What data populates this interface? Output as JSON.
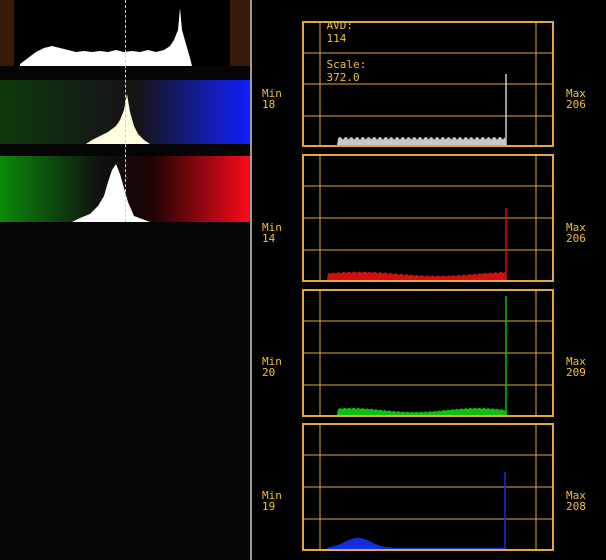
{
  "header": {
    "avd_label": "AVD:",
    "avd_value": "114",
    "scale_label": "Scale:",
    "scale_value": "372.0"
  },
  "colors": {
    "accent": "#e8a73a",
    "text": "#f2c230",
    "luma": "#c8c8c8",
    "red": "#d01010",
    "green": "#10c010",
    "blue": "#1030e0"
  },
  "left_bands": [
    {
      "name": "luma",
      "strip_colors": [
        "#3a1a08",
        "#000000",
        "#3a1a08"
      ]
    },
    {
      "name": "blue-yellow",
      "strip_colors": [
        "#0c3a0c",
        "#161616",
        "#1020ff"
      ]
    },
    {
      "name": "green-red",
      "strip_colors": [
        "#0a8a0a",
        "#101010",
        "#ff0a1a"
      ]
    }
  ],
  "panels": [
    {
      "channel": "luma",
      "min_label": "Min",
      "min_value": "18",
      "max_label": "Max",
      "max_value": "206"
    },
    {
      "channel": "red",
      "min_label": "Min",
      "min_value": "14",
      "max_label": "Max",
      "max_value": "206"
    },
    {
      "channel": "green",
      "min_label": "Min",
      "min_value": "20",
      "max_label": "Max",
      "max_value": "209"
    },
    {
      "channel": "blue",
      "min_label": "Min",
      "min_value": "19",
      "max_label": "Max",
      "max_value": "208"
    }
  ]
}
